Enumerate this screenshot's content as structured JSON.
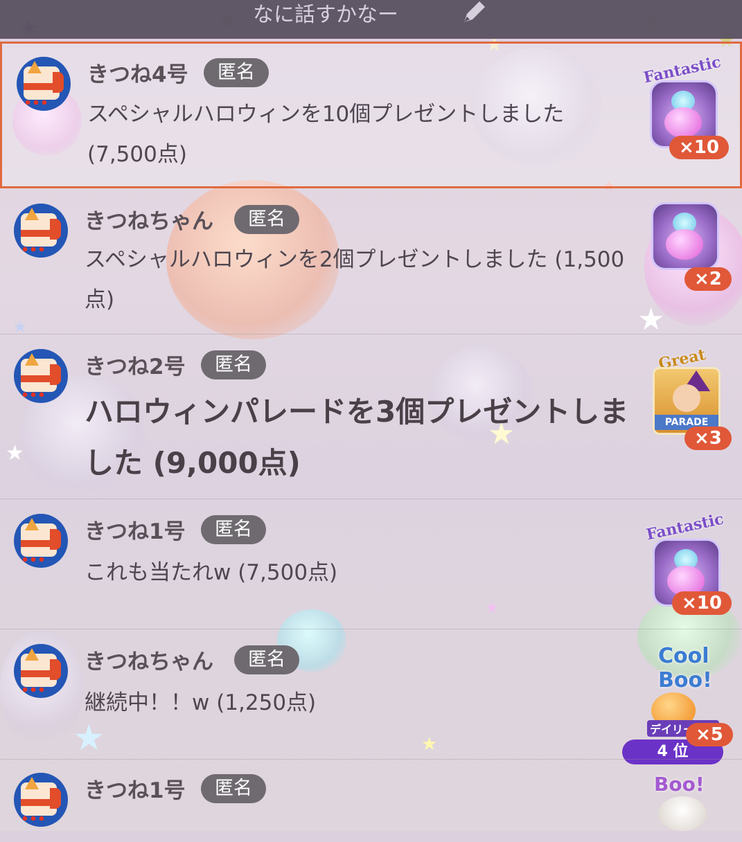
{
  "composer": {
    "placeholder": "なに話すかなー",
    "icon": "pencil-icon"
  },
  "colors": {
    "badge_bg": "#6f6a70",
    "count_bg": "#e05838",
    "highlight_border": "#e06a3e",
    "rank_bg": "#6b32c7",
    "avatar_bg": "#2456b5"
  },
  "messages": [
    {
      "name": "きつね4号",
      "badge": "匿名",
      "text": "スペシャルハロウィンを10個プレゼントしました (7,500点)",
      "gift_title": "Fantastic",
      "count": "×10",
      "highlighted": true
    },
    {
      "name": "きつねちゃん",
      "badge": "匿名",
      "text": "スペシャルハロウィンを2個プレゼントしました (1,500点)",
      "count": "×2"
    },
    {
      "name": "きつね2号",
      "badge": "匿名",
      "text": "ハロウィンパレードを3個プレゼントしました (9,000点)",
      "gift_title": "Great",
      "gift_banner": "PARADE",
      "count": "×3"
    },
    {
      "name": "きつね1号",
      "badge": "匿名",
      "text": "これも当たれw (7,500点)",
      "gift_title": "Fantastic",
      "count": "×10"
    },
    {
      "name": "きつねちゃん",
      "badge": "匿名",
      "text": "継続中！！w (1,250点)",
      "gift_title": "Cool Boo!",
      "count": "×5"
    },
    {
      "name": "きつね1号",
      "badge": "匿名",
      "gift_title": "Boo!"
    }
  ],
  "ranking": {
    "label": "デイリー総合",
    "rank": "4 位"
  }
}
